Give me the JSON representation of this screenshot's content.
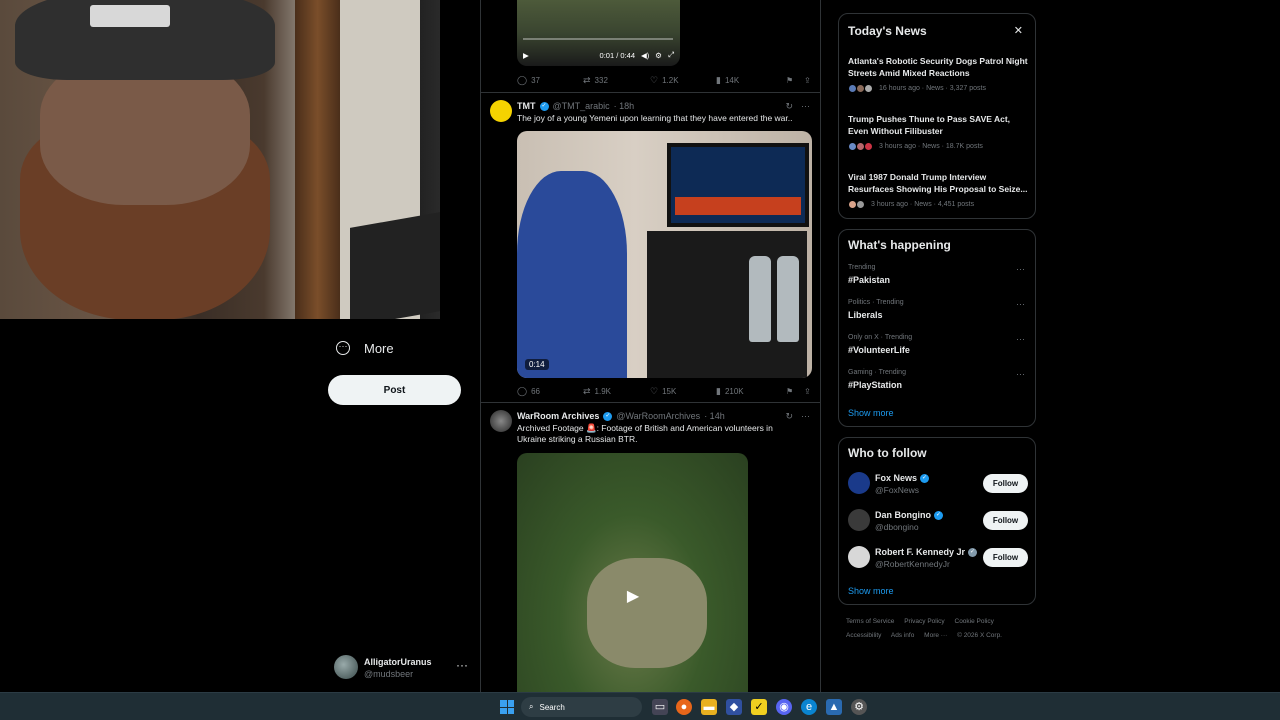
{
  "nav": {
    "more_label": "More",
    "post_label": "Post"
  },
  "account": {
    "name": "AlligatorUranus",
    "handle": "@mudsbeer"
  },
  "tweet0": {
    "video_time": "0:01 / 0:44",
    "replies": "37",
    "retweets": "332",
    "likes": "1.2K",
    "views": "14K"
  },
  "tweet1": {
    "author": "TMT",
    "handle": "@TMT_arabic",
    "time": "· 18h",
    "text": "The joy of a young Yemeni upon learning that they have entered the war..",
    "video_duration": "0:14",
    "replies": "66",
    "retweets": "1.9K",
    "likes": "15K",
    "views": "210K"
  },
  "tweet2": {
    "author": "WarRoom Archives",
    "handle": "@WarRoomArchives",
    "time": "· 14h",
    "text": "Archived Footage 🚨: Footage of British and American volunteers in Ukraine striking a Russian BTR."
  },
  "news": {
    "title": "Today's News",
    "items": [
      {
        "title": "Atlanta's Robotic Security Dogs Patrol Night Streets Amid Mixed Reactions",
        "meta": "16 hours ago · News · 3,327 posts"
      },
      {
        "title": "Trump Pushes Thune to Pass SAVE Act, Even Without Filibuster",
        "meta": "3 hours ago · News · 18.7K posts"
      },
      {
        "title": "Viral 1987 Donald Trump Interview Resurfaces Showing His Proposal to Seize...",
        "meta": "3 hours ago · News · 4,451 posts"
      }
    ]
  },
  "happening": {
    "title": "What's happening",
    "trends": [
      {
        "category": "Trending",
        "name": "#Pakistan"
      },
      {
        "category": "Politics · Trending",
        "name": "Liberals"
      },
      {
        "category": "Only on X · Trending",
        "name": "#VolunteerLife"
      },
      {
        "category": "Gaming · Trending",
        "name": "#PlayStation"
      }
    ],
    "show_more": "Show more"
  },
  "who_to_follow": {
    "title": "Who to follow",
    "accounts": [
      {
        "name": "Fox News",
        "handle": "@FoxNews",
        "button": "Follow"
      },
      {
        "name": "Dan Bongino",
        "handle": "@dbongino",
        "button": "Follow"
      },
      {
        "name": "Robert F. Kennedy Jr",
        "handle": "@RobertKennedyJr",
        "button": "Follow"
      }
    ],
    "show_more": "Show more"
  },
  "footer": {
    "links": [
      "Terms of Service",
      "Privacy Policy",
      "Cookie Policy",
      "Accessibility",
      "Ads info",
      "More ···",
      "© 2026 X Corp."
    ]
  },
  "taskbar": {
    "search_label": "Search"
  },
  "colors": {
    "accent": "#1d9bf0",
    "background": "#000000",
    "border": "#2f3336",
    "muted": "#71767b"
  },
  "icons": [
    "more-circle-icon",
    "reply-icon",
    "retweet-icon",
    "like-icon",
    "views-icon",
    "bookmark-icon",
    "share-icon",
    "grok-icon",
    "verified-icon",
    "play-icon",
    "close-icon",
    "windows-start-icon",
    "search-icon"
  ]
}
